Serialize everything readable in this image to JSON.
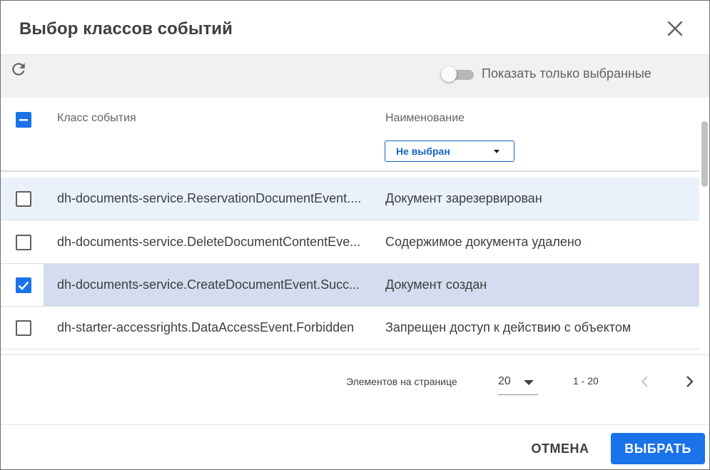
{
  "dialog": {
    "title": "Выбор классов событий",
    "close_icon": "close-icon"
  },
  "toolbar": {
    "refresh_icon": "refresh-icon",
    "toggle_on": false,
    "toggle_label": "Показать только выбранные"
  },
  "table": {
    "header_checkbox_state": "indeterminate",
    "columns": {
      "class": "Класс события",
      "name": "Наименование"
    },
    "name_filter": {
      "value": "Не выбран"
    },
    "rows": [
      {
        "class": "dh-documents-service.ReservationDocumentEvent....",
        "name": "Документ зарезервирован",
        "checked": false
      },
      {
        "class": "dh-documents-service.DeleteDocumentContentEve...",
        "name": "Содержимое документа удалено",
        "checked": false
      },
      {
        "class": "dh-documents-service.CreateDocumentEvent.Succ...",
        "name": "Документ создан",
        "checked": true
      },
      {
        "class": "dh-starter-accessrights.DataAccessEvent.Forbidden",
        "name": "Запрещен доступ к действию с объектом",
        "checked": false
      }
    ]
  },
  "paginator": {
    "items_per_page_label": "Элементов на странице",
    "page_size": "20",
    "range": "1 - 20"
  },
  "footer": {
    "cancel_label": "ОТМЕНА",
    "select_label": "ВЫБРАТЬ"
  },
  "colors": {
    "accent": "#1a73e8",
    "selected_row": "#d4dcef",
    "hover_row": "#eaf1fb",
    "toolbar_bg": "#f1f1f1"
  }
}
